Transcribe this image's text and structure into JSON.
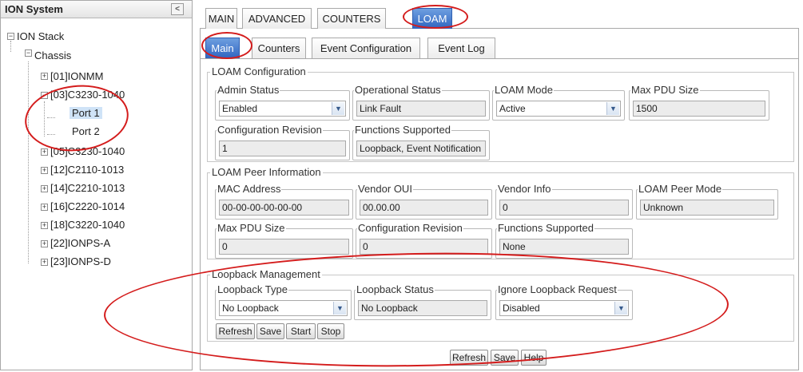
{
  "tree": {
    "title": "ION System",
    "collapse_glyph": "<",
    "nodes": [
      "ION Stack",
      "Chassis",
      "[01]IONMM",
      "[03]C3230-1040",
      "Port 1",
      "Port 2",
      "[05]C3230-1040",
      "[12]C2110-1013",
      "[14]C2210-1013",
      "[16]C2220-1014",
      "[18]C3220-1040",
      "[22]IONPS-A",
      "[23]IONPS-D"
    ],
    "expanded_glyph": "−",
    "collapsed_glyph": "+"
  },
  "top_tabs": [
    "MAIN",
    "ADVANCED",
    "COUNTERS",
    "LOAM"
  ],
  "sub_tabs": [
    "Main",
    "Counters",
    "Event Configuration",
    "Event Log"
  ],
  "loam_config": {
    "title": "LOAM Configuration",
    "admin_status": {
      "label": "Admin Status",
      "value": "Enabled"
    },
    "operational_status": {
      "label": "Operational Status",
      "value": "Link Fault"
    },
    "loam_mode": {
      "label": "LOAM Mode",
      "value": "Active"
    },
    "max_pdu": {
      "label": "Max PDU Size",
      "value": "1500"
    },
    "config_revision": {
      "label": "Configuration Revision",
      "value": "1"
    },
    "functions_supported": {
      "label": "Functions Supported",
      "value": "Loopback, Event Notification"
    }
  },
  "peer_info": {
    "title": "LOAM Peer Information",
    "mac": {
      "label": "MAC Address",
      "value": "00-00-00-00-00-00"
    },
    "vendor_oui": {
      "label": "Vendor OUI",
      "value": "00.00.00"
    },
    "vendor_info": {
      "label": "Vendor Info",
      "value": "0"
    },
    "peer_mode": {
      "label": "LOAM Peer Mode",
      "value": "Unknown"
    },
    "max_pdu": {
      "label": "Max PDU Size",
      "value": "0"
    },
    "config_revision": {
      "label": "Configuration Revision",
      "value": "0"
    },
    "functions_supported": {
      "label": "Functions Supported",
      "value": "None"
    }
  },
  "loopback": {
    "title": "Loopback Management",
    "type": {
      "label": "Loopback Type",
      "value": "No Loopback"
    },
    "status": {
      "label": "Loopback Status",
      "value": "No Loopback"
    },
    "ignore": {
      "label": "Ignore Loopback Request",
      "value": "Disabled"
    },
    "buttons": [
      "Refresh",
      "Save",
      "Start",
      "Stop"
    ]
  },
  "bottom_buttons": [
    "Refresh",
    "Save",
    "Help"
  ],
  "colors": {
    "active_tab": "#2f64c0",
    "annotation": "#d41c1c",
    "selected_node": "#cfe3f7"
  }
}
